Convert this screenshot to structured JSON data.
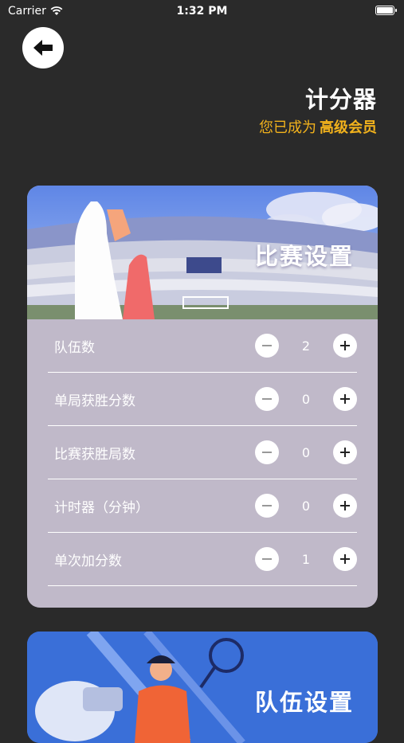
{
  "status_bar": {
    "carrier": "Carrier",
    "time": "1:32 PM"
  },
  "header": {
    "title": "计分器",
    "subtitle_prefix": "您已成为",
    "subtitle_level": "高级会员"
  },
  "match_settings": {
    "title": "比赛设置",
    "rows": [
      {
        "label": "队伍数",
        "value": "2"
      },
      {
        "label": "单局获胜分数",
        "value": "0"
      },
      {
        "label": "比赛获胜局数",
        "value": "0"
      },
      {
        "label": "计时器（分钟）",
        "value": "0"
      },
      {
        "label": "单次加分数",
        "value": "1"
      }
    ]
  },
  "team_settings": {
    "title": "队伍设置"
  },
  "colors": {
    "accent": "#f2b21c",
    "card_bg": "#c0b9c9",
    "background": "#2a2a2a"
  }
}
